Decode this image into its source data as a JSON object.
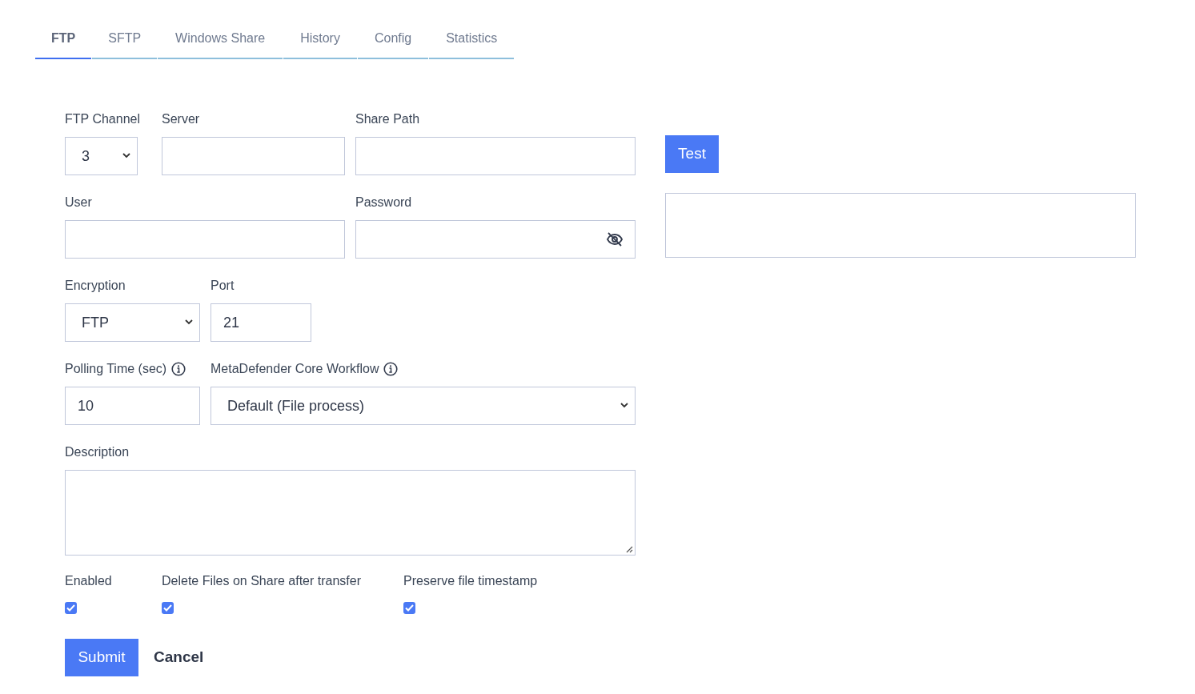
{
  "tabs": [
    {
      "label": "FTP",
      "selected": true
    },
    {
      "label": "SFTP",
      "selected": false
    },
    {
      "label": "Windows Share",
      "selected": false
    },
    {
      "label": "History",
      "selected": false
    },
    {
      "label": "Config",
      "selected": false
    },
    {
      "label": "Statistics",
      "selected": false
    }
  ],
  "rows": [
    [
      {
        "label": "FTP Channel",
        "kind": "select",
        "value": "3"
      },
      {
        "label": "Server",
        "kind": "text"
      },
      {
        "label": "Share Path",
        "kind": "text"
      }
    ],
    [
      {
        "label": "User",
        "kind": "text"
      },
      {
        "label": "Password",
        "kind": "password"
      }
    ],
    [
      {
        "label": "Encryption",
        "kind": "select",
        "value": "FTP"
      },
      {
        "label": "Port",
        "kind": "text",
        "value": "21"
      }
    ],
    [
      {
        "label": "Polling Time (sec)",
        "kind": "text",
        "value": "10",
        "info": true
      },
      {
        "label": "MetaDefender Core Workflow",
        "kind": "select",
        "value": "Default (File process)",
        "info": true
      }
    ]
  ],
  "description": {
    "label": "Description"
  },
  "checkboxes": [
    {
      "label": "Enabled",
      "checked": true
    },
    {
      "label": "Delete Files on Share after transfer",
      "checked": true
    },
    {
      "label": "Preserve file timestamp",
      "checked": true
    }
  ],
  "test_button": "Test",
  "submit": "Submit",
  "cancel": "Cancel"
}
